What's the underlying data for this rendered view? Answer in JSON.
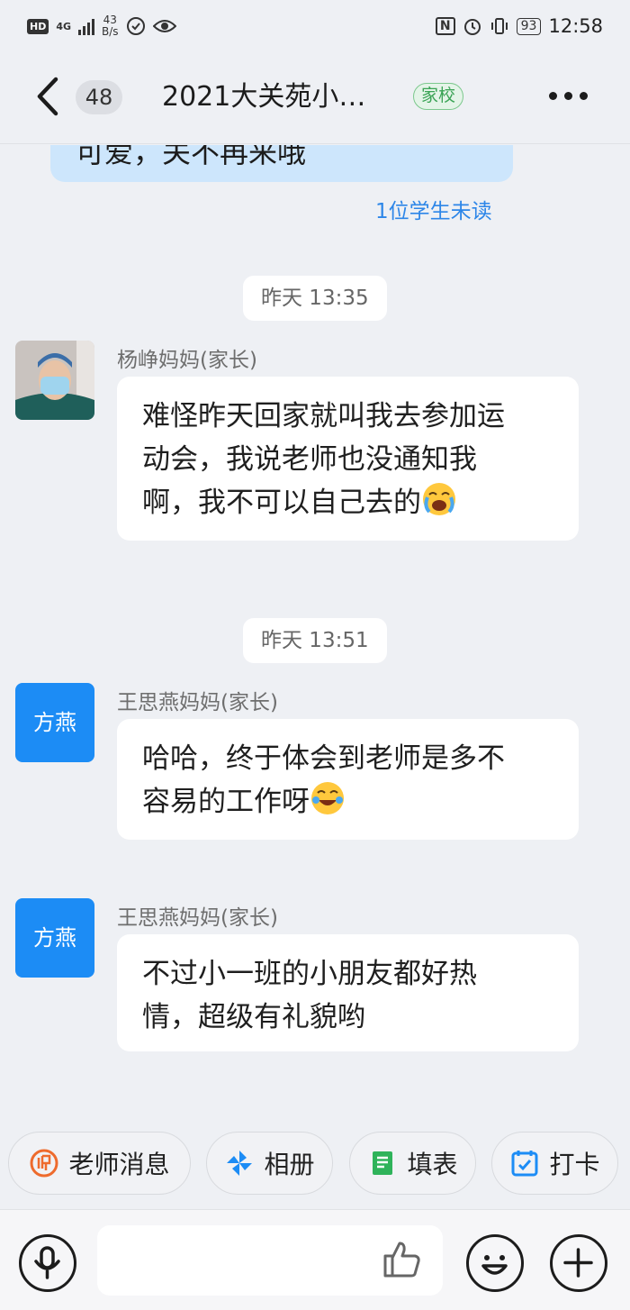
{
  "status_bar": {
    "hd": "HD",
    "network": "4G",
    "speed_value": "43",
    "speed_unit": "B/s",
    "nfc": "N",
    "battery": "93",
    "time": "12:58"
  },
  "header": {
    "unread_count": "48",
    "title": "2021大关苑小…",
    "tag": "家校"
  },
  "chat": {
    "previous_message": "可爱，关不再来哦",
    "unread_note": "1位学生未读",
    "messages": [
      {
        "time": "昨天 13:35",
        "sender": "杨峥妈妈(家长)",
        "avatar_type": "photo",
        "text_lines": [
          "难怪昨天回家就叫我去参加运",
          "动会，我说老师也没通知我",
          "啊，我不可以自己去的"
        ],
        "emoji": "crying-laughing"
      },
      {
        "time": "昨天 13:51",
        "sender": "王思燕妈妈(家长)",
        "avatar_text": "方燕",
        "text_lines": [
          "哈哈，终于体会到老师是多不",
          "容易的工作呀"
        ],
        "emoji": "tears-of-joy"
      },
      {
        "sender": "王思燕妈妈(家长)",
        "avatar_text": "方燕",
        "text_lines": [
          "不过小一班的小朋友都好热",
          "情，超级有礼貌哟"
        ]
      }
    ]
  },
  "quick_actions": [
    {
      "label": "老师消息",
      "icon": "teacher-icon",
      "color": "#ee6b2d"
    },
    {
      "label": "相册",
      "icon": "pinwheel-icon",
      "color": "#1c8cf5"
    },
    {
      "label": "填表",
      "icon": "form-icon",
      "color": "#2fb35a"
    },
    {
      "label": "打卡",
      "icon": "calendar-check-icon",
      "color": "#1c8cf5"
    }
  ],
  "input_bar": {
    "voice_icon": "microphone-icon",
    "like_icon": "thumbs-up-icon",
    "emoji_icon": "smiley-icon",
    "plus_icon": "plus-icon"
  },
  "colors": {
    "accent_blue": "#1c8cf5",
    "bubble_self": "#cde6fc",
    "tag_green": "#3aa355"
  }
}
